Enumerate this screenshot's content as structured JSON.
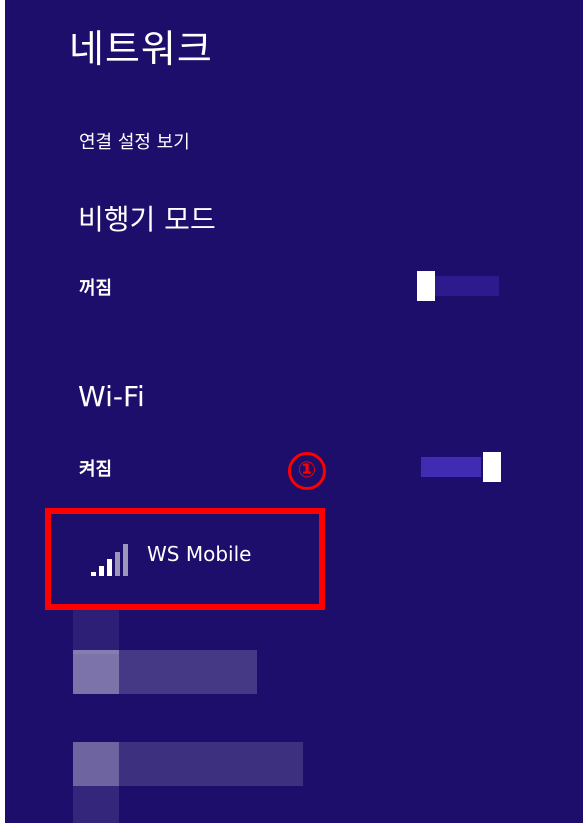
{
  "panel": {
    "title": "네트워크",
    "view_connection_settings": "연결 설정 보기"
  },
  "airplane_mode": {
    "heading": "비행기 모드",
    "state_label": "꺼짐",
    "enabled": false
  },
  "wifi": {
    "heading": "Wi-Fi",
    "state_label": "켜짐",
    "enabled": true
  },
  "annotation": {
    "step_marker": "①"
  },
  "networks": [
    {
      "name": "WS Mobile",
      "icon": "wifi-signal-icon"
    }
  ],
  "colors": {
    "background": "#1d0e6b",
    "highlight": "#ff0000",
    "text": "#ffffff"
  }
}
